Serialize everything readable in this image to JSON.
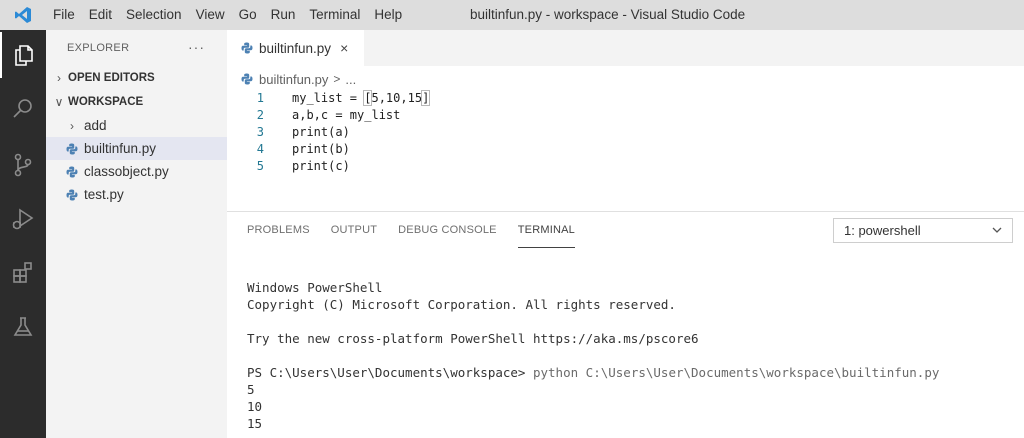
{
  "titlebar": {
    "menu": [
      "File",
      "Edit",
      "Selection",
      "View",
      "Go",
      "Run",
      "Terminal",
      "Help"
    ],
    "window_title": "builtinfun.py - workspace - Visual Studio Code"
  },
  "activity_bar": {
    "items": [
      "explorer-icon",
      "search-icon",
      "source-control-icon",
      "run-debug-icon",
      "extensions-icon",
      "testing-icon"
    ],
    "accent_color": "#ffffff"
  },
  "sidebar": {
    "header": "EXPLORER",
    "more": "···",
    "open_editors": "OPEN EDITORS",
    "workspace": "WORKSPACE",
    "items": [
      {
        "label": "add",
        "type": "folder"
      },
      {
        "label": "builtinfun.py",
        "type": "python",
        "selected": true
      },
      {
        "label": "classobject.py",
        "type": "python"
      },
      {
        "label": "test.py",
        "type": "python"
      }
    ]
  },
  "editor": {
    "tab_label": "builtinfun.py",
    "tab_close": "×",
    "breadcrumb_file": "builtinfun.py",
    "breadcrumb_sep": ">",
    "breadcrumb_more": "...",
    "lines": [
      {
        "num": "1",
        "pre": "my_list = ",
        "hl_open": "[",
        "mid": "5,10,15",
        "hl_close": "]"
      },
      {
        "num": "2",
        "text": "a,b,c = my_list"
      },
      {
        "num": "3",
        "text": "print(a)"
      },
      {
        "num": "4",
        "text": "print(b)"
      },
      {
        "num": "5",
        "text": "print(c)"
      }
    ]
  },
  "panel": {
    "tabs": [
      "PROBLEMS",
      "OUTPUT",
      "DEBUG CONSOLE",
      "TERMINAL"
    ],
    "active_tab": "TERMINAL",
    "terminal_select": "1: powershell",
    "terminal": {
      "line1": "Windows PowerShell",
      "line2": "Copyright (C) Microsoft Corporation. All rights reserved.",
      "line3": "",
      "line4": "Try the new cross-platform PowerShell https://aka.ms/pscore6",
      "line5": "",
      "prompt": "PS C:\\Users\\User\\Documents\\workspace> ",
      "command": "python C:\\Users\\User\\Documents\\workspace\\builtinfun.py",
      "output": [
        "5",
        "10",
        "15"
      ]
    }
  },
  "colors": {
    "activity_bar_bg": "#2c2c2c",
    "sidebar_bg": "#f3f3f3",
    "selected_bg": "#e4e6f1",
    "line_number": "#237893",
    "python_icon": "#4d81b3"
  }
}
